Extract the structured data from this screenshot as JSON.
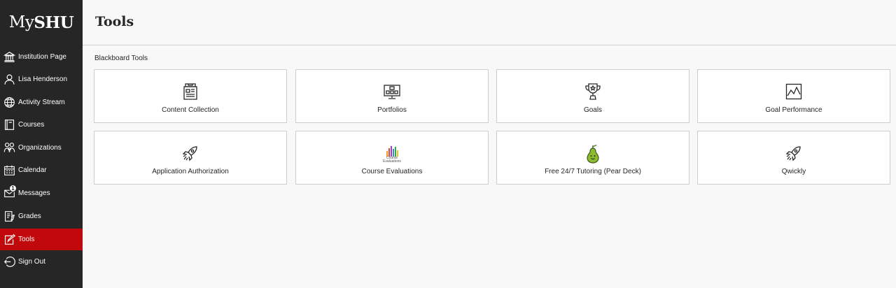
{
  "brand": {
    "logo_light": "My",
    "logo_bold": "SHU"
  },
  "sidebar": {
    "items": [
      {
        "label": "Institution Page",
        "icon": "institution-icon",
        "active": false
      },
      {
        "label": "Lisa Henderson",
        "icon": "user-icon",
        "active": false
      },
      {
        "label": "Activity Stream",
        "icon": "globe-icon",
        "active": false
      },
      {
        "label": "Courses",
        "icon": "book-icon",
        "active": false
      },
      {
        "label": "Organizations",
        "icon": "people-icon",
        "active": false
      },
      {
        "label": "Calendar",
        "icon": "calendar-icon",
        "active": false
      },
      {
        "label": "Messages",
        "icon": "envelope-icon",
        "active": false,
        "badge": "1"
      },
      {
        "label": "Grades",
        "icon": "grades-icon",
        "active": false
      },
      {
        "label": "Tools",
        "icon": "edit-icon",
        "active": true
      },
      {
        "label": "Sign Out",
        "icon": "sign-out-icon",
        "active": false
      }
    ]
  },
  "header": {
    "title": "Tools"
  },
  "main": {
    "section_title": "Blackboard Tools",
    "tools": [
      {
        "label": "Content Collection",
        "icon": "content-collection-icon"
      },
      {
        "label": "Portfolios",
        "icon": "portfolios-icon"
      },
      {
        "label": "Goals",
        "icon": "trophy-icon"
      },
      {
        "label": "Goal Performance",
        "icon": "line-chart-icon"
      },
      {
        "label": "Application Authorization",
        "icon": "rocket-icon"
      },
      {
        "label": "Course Evaluations",
        "icon": "course-evaluations-logo",
        "logo_text_1": "Course",
        "logo_text_2": "Evaluations"
      },
      {
        "label": "Free 24/7 Tutoring (Pear Deck)",
        "icon": "pear-icon"
      },
      {
        "label": "Qwickly",
        "icon": "rocket-icon"
      }
    ]
  },
  "colors": {
    "sidebar_bg": "#262626",
    "active_bg": "#c1090b",
    "page_bg": "#f8f8f8",
    "pear_green": "#8dbb2e"
  }
}
